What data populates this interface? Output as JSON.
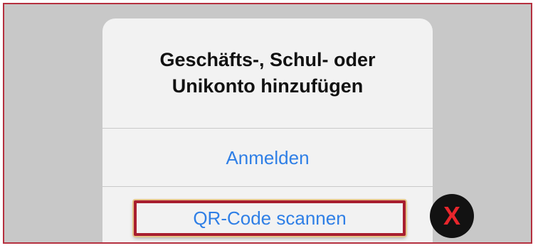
{
  "dialog": {
    "title_line1": "Geschäfts-, Schul- oder",
    "title_line2": "Unikonto hinzufügen",
    "signin_label": "Anmelden",
    "qr_label": "QR-Code scannen"
  },
  "annotation": {
    "badge_text": "X"
  },
  "colors": {
    "frame_border": "#b5303f",
    "backdrop": "#c8c8c8",
    "dialog_bg": "#f2f2f2",
    "action_blue": "#2f7fe6",
    "highlight_border": "#a81e2f",
    "badge_bg": "#121212",
    "badge_x": "#e8262c"
  }
}
